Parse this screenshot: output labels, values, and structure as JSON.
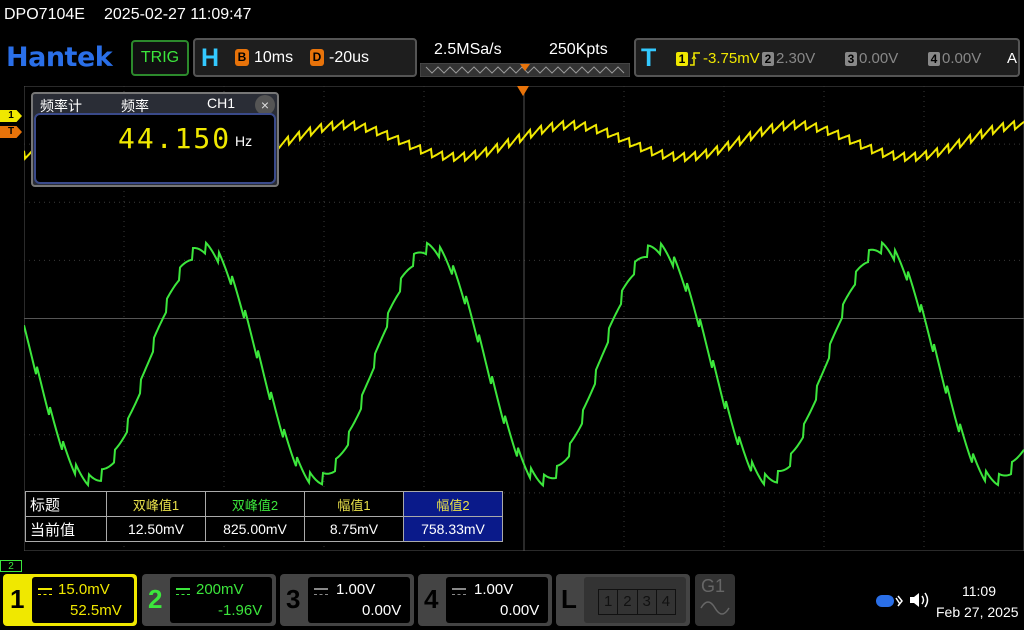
{
  "header": {
    "model": "DPO7104E",
    "datetime": "2025-02-27 11:09:47"
  },
  "toolbar": {
    "logo": "Hantek",
    "trig_label": "TRIG",
    "h_label": "H",
    "timebase_badge": "B",
    "timebase": "10ms",
    "delay_badge": "D",
    "delay": "-20us",
    "sample_rate": "2.5MSa/s",
    "record_length": "250Kpts",
    "t_label": "T",
    "trigger_channels": [
      {
        "num": "1",
        "value": "-3.75mV",
        "color": "#f0e800"
      },
      {
        "num": "2",
        "value": "2.30V",
        "color": "#777777"
      },
      {
        "num": "3",
        "value": "0.00V",
        "color": "#777777"
      },
      {
        "num": "4",
        "value": "0.00V",
        "color": "#777777"
      }
    ],
    "trigger_mode": "A"
  },
  "markers": {
    "ch1": "1",
    "trigger": "T",
    "ch2": "2"
  },
  "freq_panel": {
    "title1": "频率计",
    "title2": "频率",
    "channel": "CH1",
    "close": "×",
    "value": "44.150",
    "unit": "Hz"
  },
  "measure_table": {
    "row_header_title": "标题",
    "row_header_value": "当前值",
    "columns": [
      {
        "name": "双峰值1",
        "value": "12.50mV",
        "color": "#e8e04a"
      },
      {
        "name": "双峰值2",
        "value": "825.00mV",
        "color": "#3ce63c"
      },
      {
        "name": "幅值1",
        "value": "8.75mV",
        "color": "#e8e04a"
      },
      {
        "name": "幅值2",
        "value": "758.33mV",
        "color": "#e8e04a"
      }
    ]
  },
  "channels": [
    {
      "num": "1",
      "scale": "15.0mV",
      "offset": "52.5mV",
      "color": "#f0e800"
    },
    {
      "num": "2",
      "scale": "200mV",
      "offset": "-1.96V",
      "color": "#3ce63c"
    },
    {
      "num": "3",
      "scale": "1.00V",
      "offset": "0.00V",
      "color": "#888888"
    },
    {
      "num": "4",
      "scale": "1.00V",
      "offset": "0.00V",
      "color": "#888888"
    }
  ],
  "logic_label": "L",
  "logic_boxes": [
    "1",
    "2",
    "3",
    "4"
  ],
  "generator_label": "G1",
  "status": {
    "time": "11:09",
    "date": "Feb 27, 2025",
    "icons": [
      "battery-icon",
      "speaker-icon"
    ]
  },
  "colors": {
    "ch1": "#f0e800",
    "ch2": "#3ce63c",
    "accent": "#33c9ff",
    "trigger_marker": "#e8730a"
  },
  "waveforms": {
    "ch1": {
      "frequency_hz": 44.15,
      "visual_color": "#f0e800"
    },
    "ch2": {
      "frequency_hz": 44.15,
      "visual_color": "#3ce63c"
    }
  }
}
